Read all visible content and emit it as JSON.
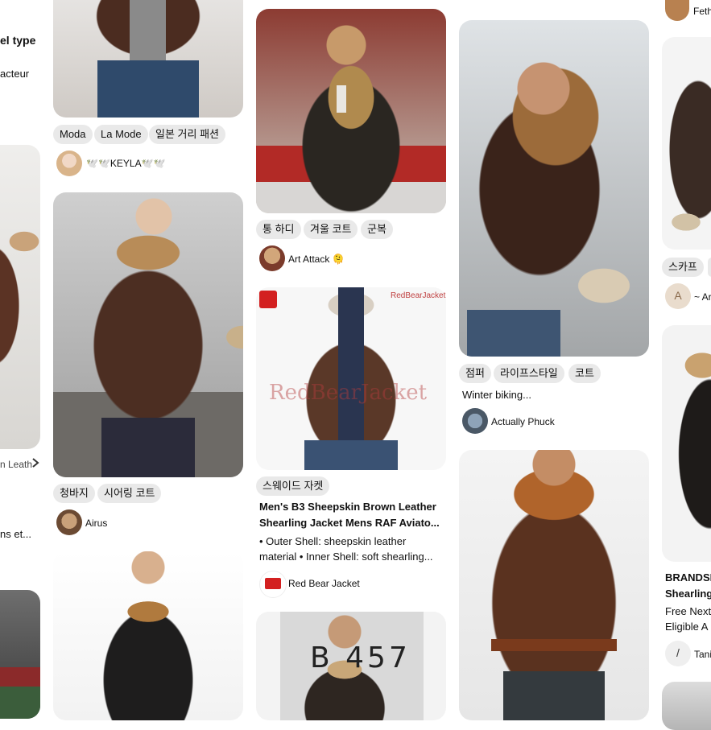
{
  "col0": {
    "title_fragment": "el type",
    "text_fragment": "acteur",
    "link_fragment": "n Leath",
    "chevron": "chevron-right-icon",
    "desc_fragment": "ns et..."
  },
  "pin_a": {
    "chips": [
      "Moda",
      "La Mode",
      "일본 거리 패션"
    ],
    "user": "🕊️🕊️KEYLA🕊️🕊️"
  },
  "pin_b": {
    "chips": [
      "청바지",
      "시어링 코트"
    ],
    "user": "Airus"
  },
  "pin_c": {
    "chips": [
      "통 하디",
      "겨울 코트",
      "군복"
    ],
    "user": "Art Attack 🫠"
  },
  "pin_d": {
    "watermark_tag": "RedBearJacket",
    "watermark": "RedBearJacket",
    "chips": [
      "스웨이드 자켓"
    ],
    "title": "Men's B3 Sheepskin Brown Leather Shearling Jacket Mens RAF Aviato...",
    "desc": "• Outer Shell: sheepskin leather material • Inner Shell: soft shearling...",
    "user": "Red Bear Jacket"
  },
  "pin_e": {
    "image_text": "B 457"
  },
  "pin_f": {
    "chips": [
      "점퍼",
      "라이프스타일",
      "코트"
    ],
    "title": "Winter biking...",
    "user": "Actually Phuck"
  },
  "col4": {
    "top_user": "Feth",
    "chips": [
      "스카프"
    ],
    "user_initial": "A",
    "user": "~ Ar",
    "title": "BRANDSI Shearling",
    "desc": "Free Next Eligible A",
    "user2_initial": "/",
    "user2": "Tani"
  },
  "colors": {
    "chip_bg": "#e9e9e9",
    "leather_brown": "#4a2f22",
    "shearling": "#b58a55"
  }
}
